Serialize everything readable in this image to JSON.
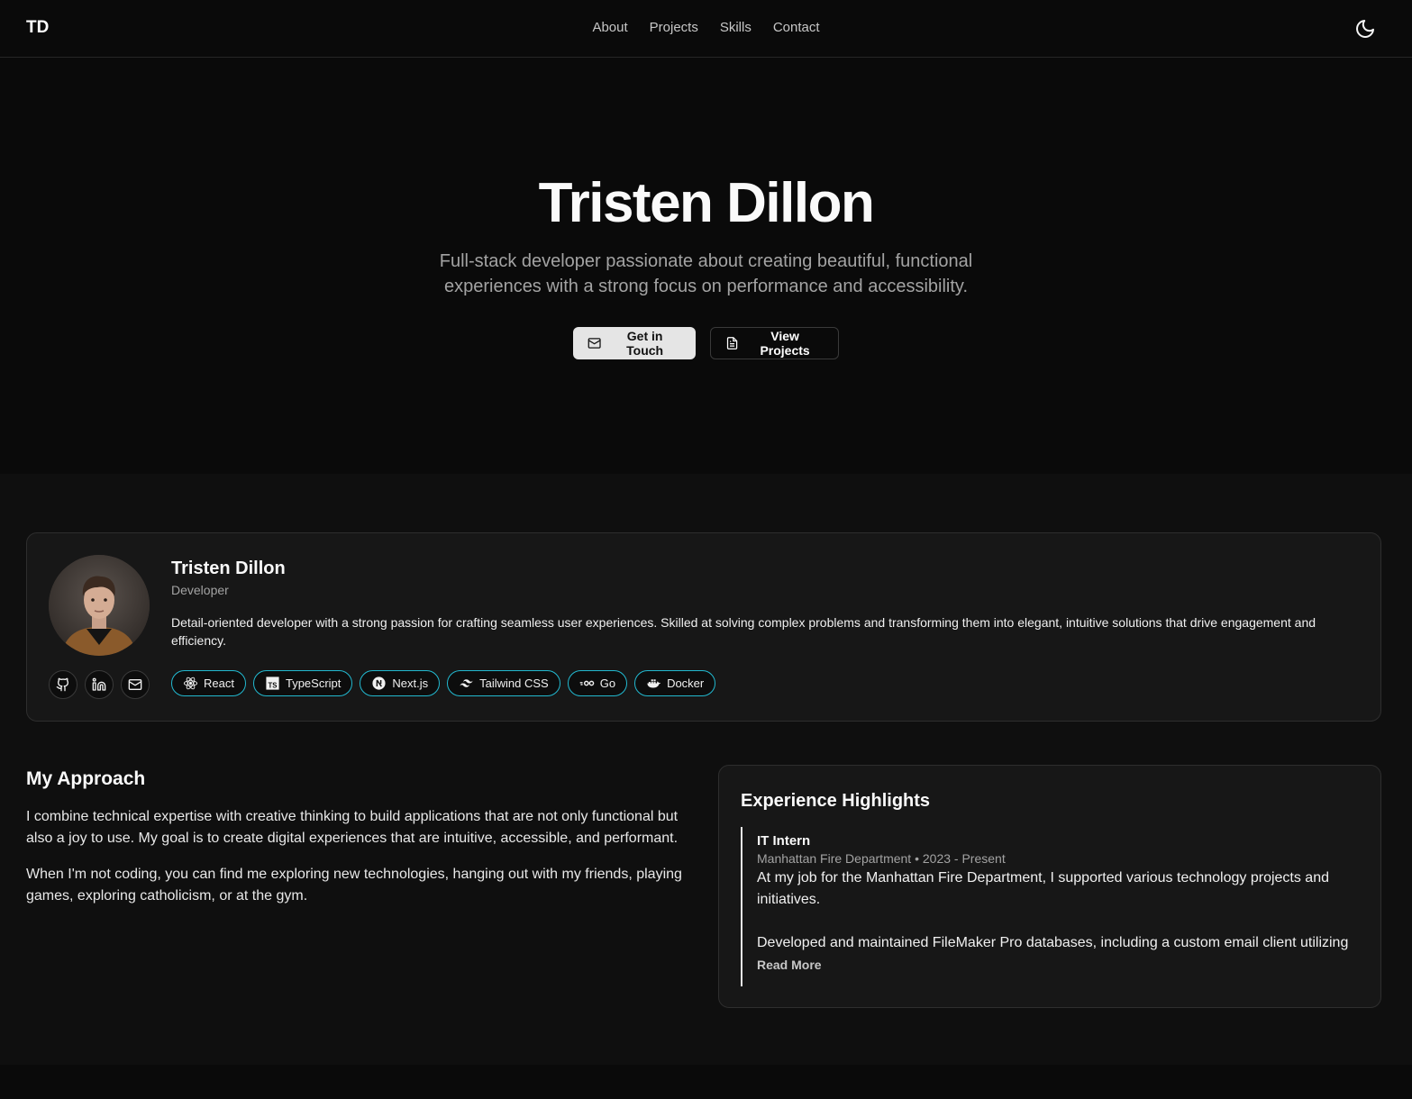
{
  "nav": {
    "logo": "TD",
    "links": [
      "About",
      "Projects",
      "Skills",
      "Contact"
    ],
    "theme_toggle_icon": "moon-icon"
  },
  "hero": {
    "title": "Tristen Dillon",
    "subtitle": "Full-stack developer passionate about creating beautiful, functional experiences with a strong focus on performance and accessibility.",
    "primary_button": "Get in Touch",
    "secondary_button": "View Projects"
  },
  "profile": {
    "name": "Tristen Dillon",
    "role": "Developer",
    "bio": "Detail-oriented developer with a strong passion for crafting seamless user experiences. Skilled at solving complex problems and transforming them into elegant, intuitive solutions that drive engagement and efficiency.",
    "socials": [
      "github-icon",
      "linkedin-icon",
      "mail-icon"
    ],
    "tags": [
      "React",
      "TypeScript",
      "Next.js",
      "Tailwind CSS",
      "Go",
      "Docker"
    ],
    "tag_border_color": "#22b8cf"
  },
  "approach": {
    "title": "My Approach",
    "paragraphs": [
      "I combine technical expertise with creative thinking to build applications that are not only functional but also a joy to use. My goal is to create digital experiences that are intuitive, accessible, and performant.",
      "When I'm not coding, you can find me exploring new technologies, hanging out with my friends, playing games, exploring catholicism, or at the gym."
    ]
  },
  "experience": {
    "title": "Experience Highlights",
    "items": [
      {
        "role": "IT Intern",
        "meta": "Manhattan Fire Department • 2023 - Present",
        "desc_1": "At my job for the Manhattan Fire Department, I supported various technology projects and initiatives.",
        "desc_2": "Developed and maintained FileMaker Pro databases, including a custom email client utilizing",
        "read_more": "Read More"
      }
    ]
  }
}
